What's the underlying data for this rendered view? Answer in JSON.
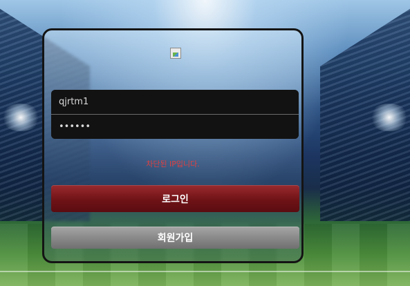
{
  "login_form": {
    "username_value": "qjrtm1",
    "password_value": "••••••",
    "error_message": "차단된 IP입니다.",
    "login_button_label": "로그인",
    "signup_button_label": "회원가입"
  },
  "colors": {
    "error": "#e04040",
    "login_button": "#7a1a1e",
    "signup_button": "#8a8a8a",
    "field_background": "#121212"
  },
  "icons": {
    "logo": "broken-image-icon"
  }
}
